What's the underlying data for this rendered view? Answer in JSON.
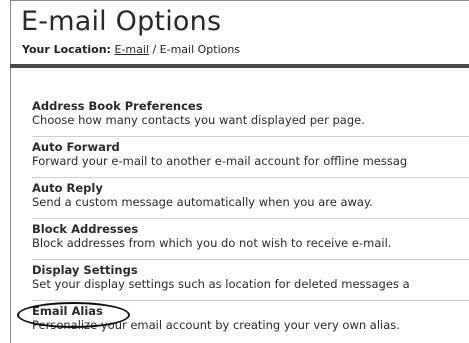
{
  "page": {
    "title": "E-mail Options"
  },
  "breadcrumb": {
    "label": "Your Location:",
    "link": "E-mail",
    "separator": "/",
    "current": "E-mail Options"
  },
  "options": [
    {
      "title": "Address Book Preferences",
      "description": "Choose how many contacts you want displayed per page."
    },
    {
      "title": "Auto Forward",
      "description": "Forward your e-mail to another e-mail account for offline messag"
    },
    {
      "title": "Auto Reply",
      "description": "Send a custom message automatically when you are away."
    },
    {
      "title": "Block Addresses",
      "description": "Block addresses from which you do not wish to receive e-mail."
    },
    {
      "title": "Display Settings",
      "description": "Set your display settings such as location for deleted messages a"
    },
    {
      "title": "Email Alias",
      "description": "Personalize your email account by creating your very own alias."
    }
  ]
}
